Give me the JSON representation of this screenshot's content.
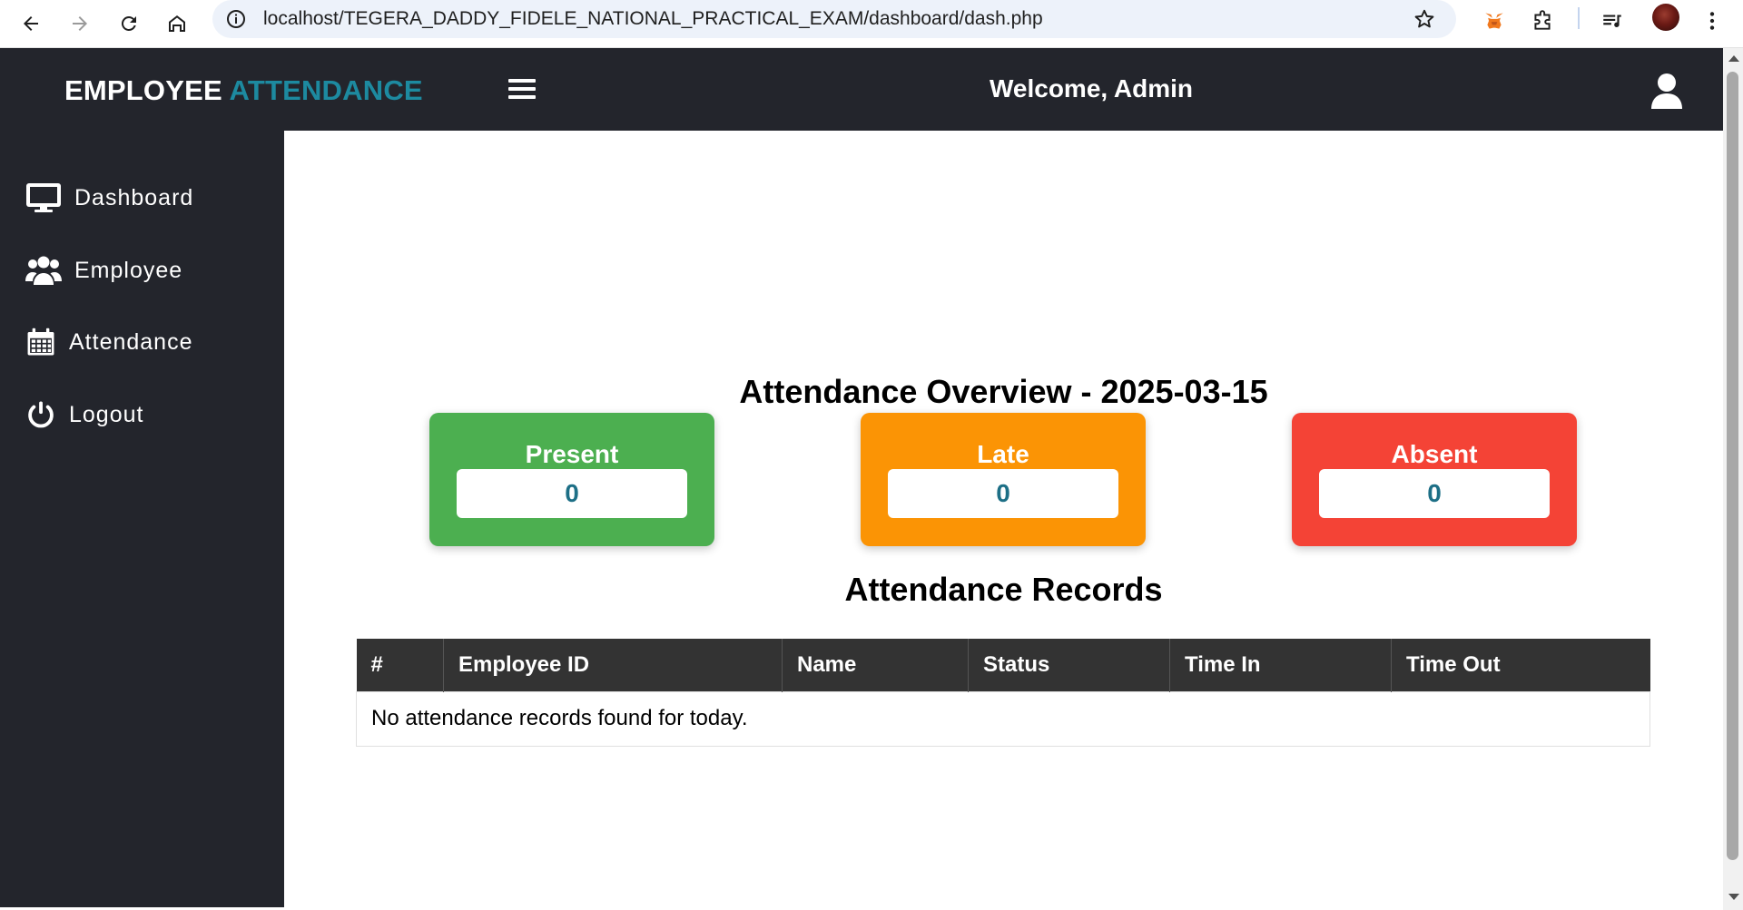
{
  "browser": {
    "url": "localhost/TEGERA_DADDY_FIDELE_NATIONAL_PRACTICAL_EXAM/dashboard/dash.php"
  },
  "header": {
    "brand_primary": "EMPLOYEE",
    "brand_accent": "ATTENDANCE",
    "welcome": "Welcome, Admin"
  },
  "sidebar": {
    "items": [
      {
        "label": "Dashboard",
        "icon": "monitor-icon"
      },
      {
        "label": "Employee",
        "icon": "users-icon"
      },
      {
        "label": "Attendance",
        "icon": "calendar-icon"
      },
      {
        "label": "Logout",
        "icon": "power-icon"
      }
    ]
  },
  "overview": {
    "title": "Attendance Overview - 2025-03-15",
    "cards": [
      {
        "label": "Present",
        "value": "0",
        "color": "#4caf50"
      },
      {
        "label": "Late",
        "value": "0",
        "color": "#fb9405"
      },
      {
        "label": "Absent",
        "value": "0",
        "color": "#f44336"
      }
    ]
  },
  "records": {
    "title": "Attendance Records",
    "columns": [
      "#",
      "Employee ID",
      "Name",
      "Status",
      "Time In",
      "Time Out"
    ],
    "empty_message": "No attendance records found for today."
  },
  "colors": {
    "header_bg": "#23252c",
    "brand_accent": "#1d8aa0",
    "value_text": "#1d6f86"
  }
}
